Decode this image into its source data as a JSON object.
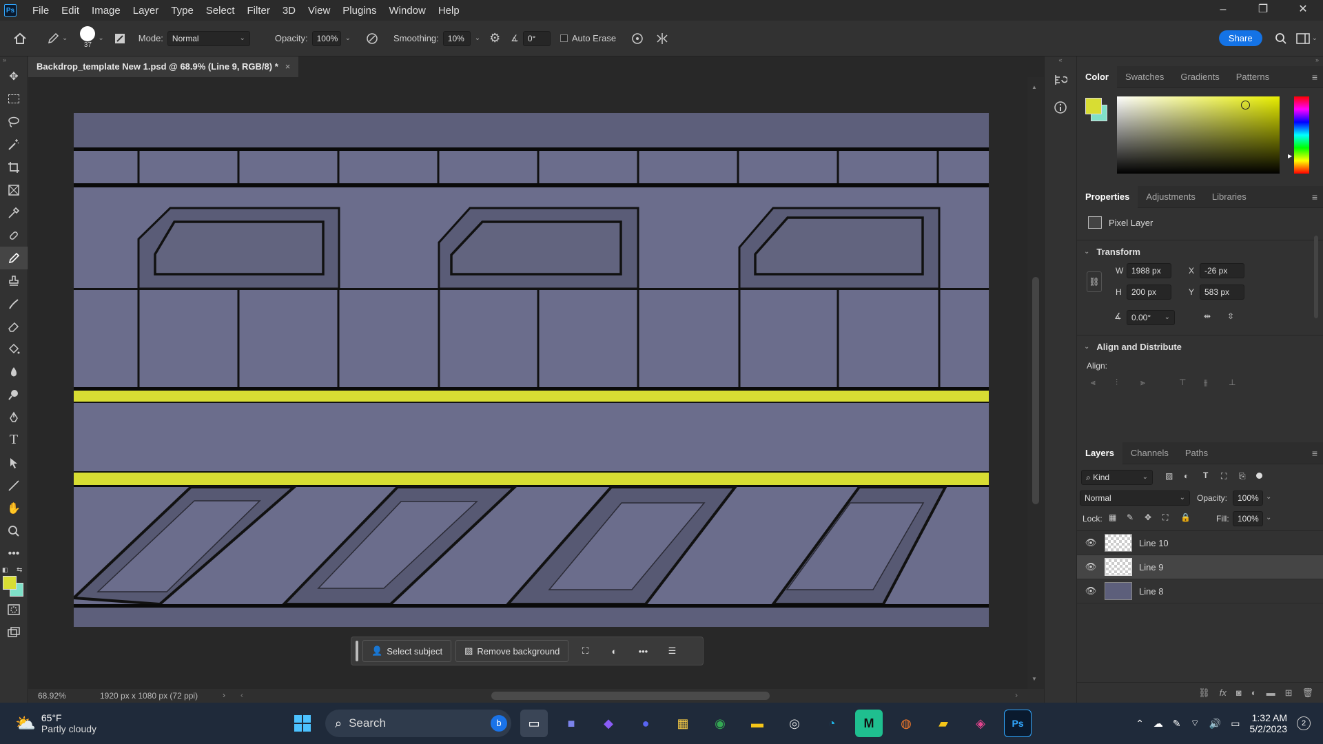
{
  "app": {
    "logo": "Ps"
  },
  "menu": [
    "File",
    "Edit",
    "Image",
    "Layer",
    "Type",
    "Select",
    "Filter",
    "3D",
    "View",
    "Plugins",
    "Window",
    "Help"
  ],
  "window_controls": {
    "minimize": "–",
    "restore": "❐",
    "close": "✕"
  },
  "options": {
    "brush_size": "37",
    "mode_label": "Mode:",
    "mode_value": "Normal",
    "opacity_label": "Opacity:",
    "opacity_value": "100%",
    "smoothing_label": "Smoothing:",
    "smoothing_value": "10%",
    "angle_value": "0°",
    "auto_erase": "Auto Erase",
    "share": "Share"
  },
  "document": {
    "tab_title": "Backdrop_template New 1.psd @ 68.9% (Line 9, RGB/8) *",
    "zoom": "68.92%",
    "doc_info": "1920 px x 1080 px (72 ppi)"
  },
  "contextual_bar": {
    "select_subject": "Select subject",
    "remove_background": "Remove background"
  },
  "color_panel": {
    "tabs": [
      "Color",
      "Swatches",
      "Gradients",
      "Patterns"
    ],
    "foreground": "#d8dd33",
    "background": "#7fe0c8"
  },
  "properties": {
    "tabs": [
      "Properties",
      "Adjustments",
      "Libraries"
    ],
    "kind": "Pixel Layer",
    "transform_title": "Transform",
    "w_label": "W",
    "w": "1988 px",
    "x_label": "X",
    "x": "-26 px",
    "h_label": "H",
    "h": "200 px",
    "y_label": "Y",
    "y": "583 px",
    "angle": "0.00°",
    "align_title": "Align and Distribute",
    "align_label": "Align:"
  },
  "layers": {
    "tabs": [
      "Layers",
      "Channels",
      "Paths"
    ],
    "filter": "Kind",
    "blend": "Normal",
    "opacity_label": "Opacity:",
    "opacity": "100%",
    "lock_label": "Lock:",
    "fill_label": "Fill:",
    "fill": "100%",
    "items": [
      {
        "name": "Line 10",
        "selected": false
      },
      {
        "name": "Line 9",
        "selected": true
      },
      {
        "name": "Line 8",
        "selected": false
      }
    ]
  },
  "taskbar": {
    "weather_temp": "65°F",
    "weather_desc": "Partly cloudy",
    "search": "Search",
    "time": "1:32 AM",
    "date": "5/2/2023",
    "notifications": "2"
  }
}
